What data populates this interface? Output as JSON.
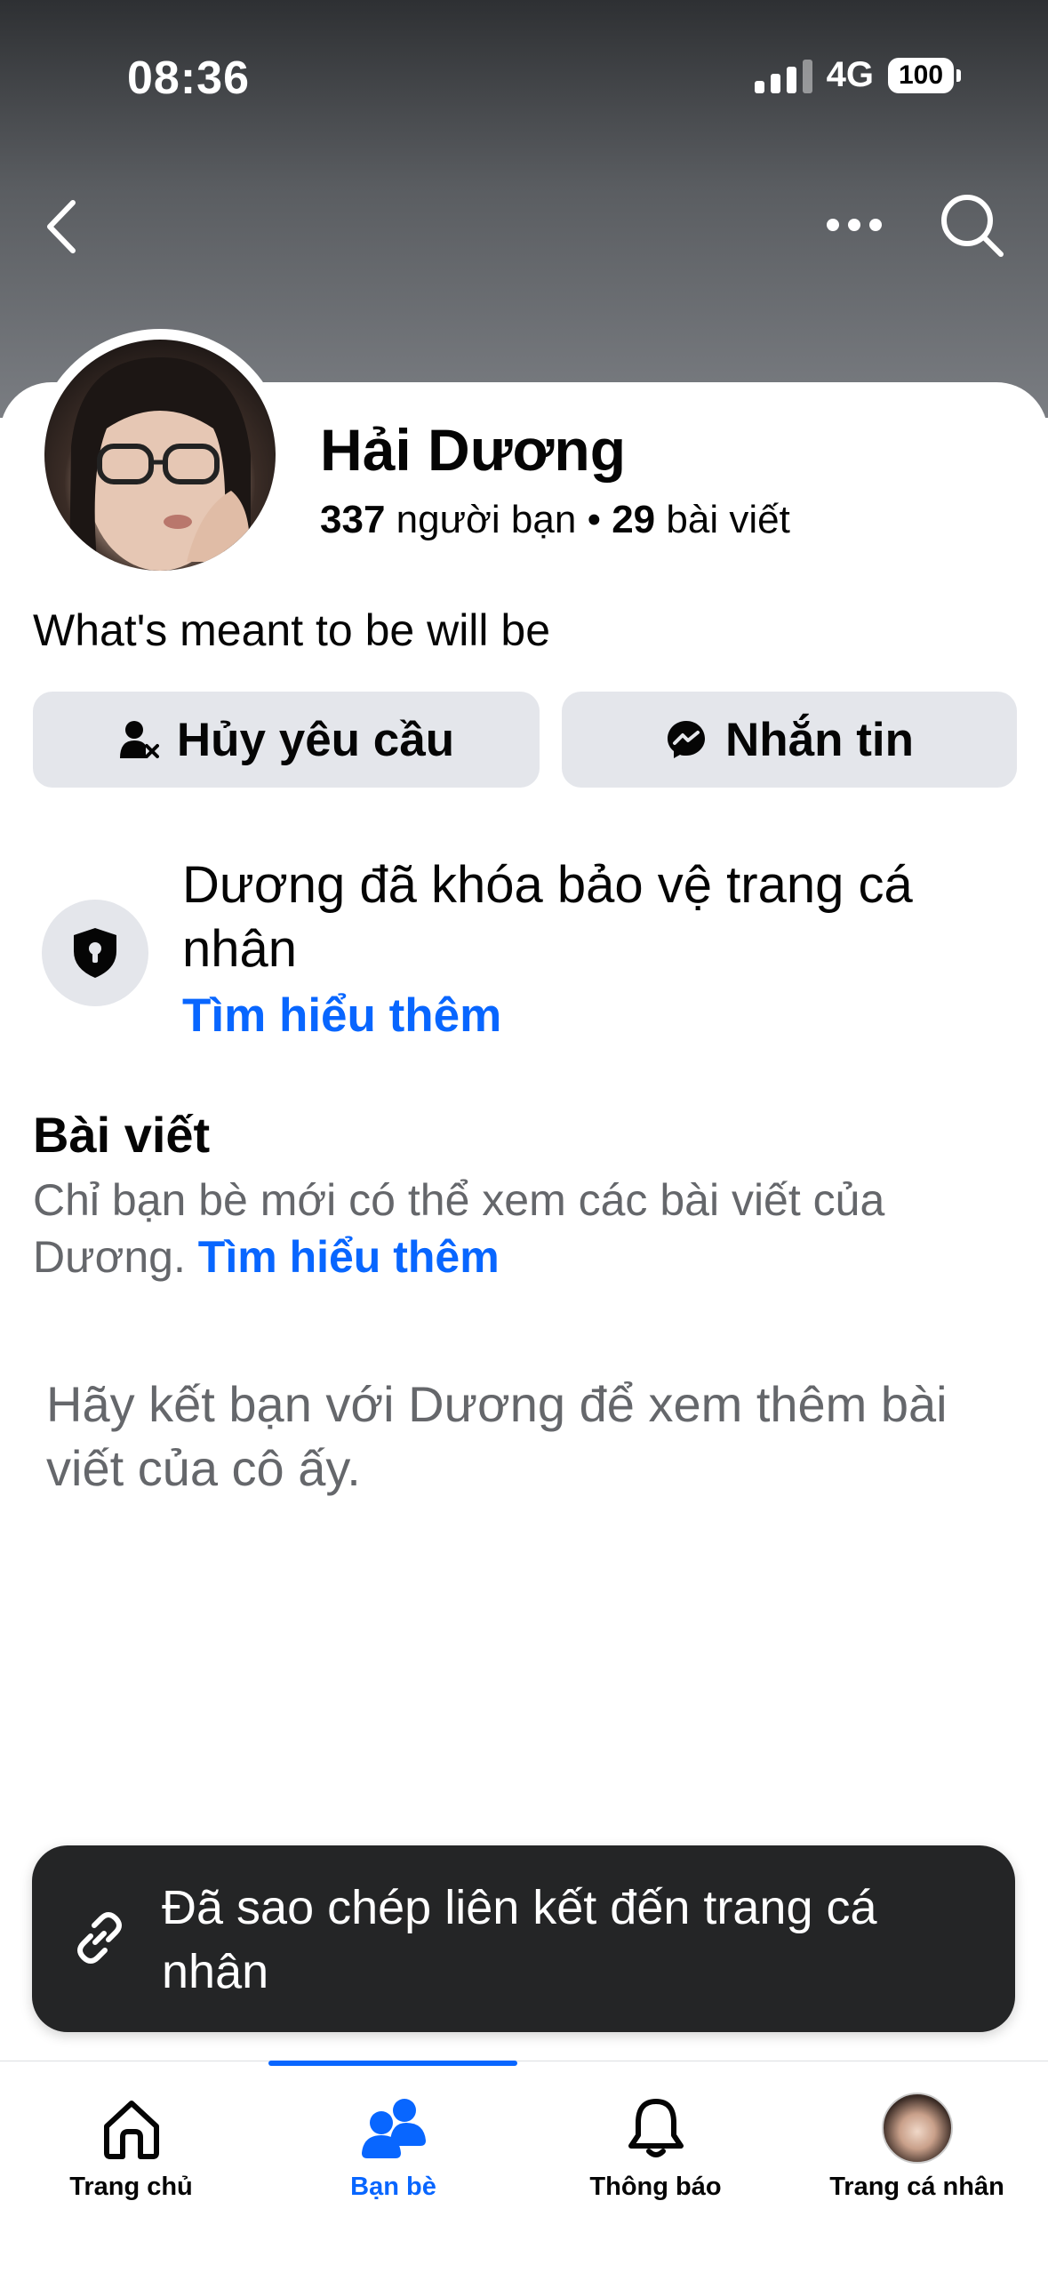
{
  "status_bar": {
    "time": "08:36",
    "network": "4G",
    "battery": "100"
  },
  "nav": {
    "back_icon": "chevron-left-icon",
    "more_icon": "more-horizontal-icon",
    "search_icon": "search-icon"
  },
  "profile": {
    "name": "Hải Dương",
    "friends_count": "337",
    "friends_label": "người bạn",
    "separator": "•",
    "posts_count": "29",
    "posts_label": "bài viết",
    "bio": "What's meant to be will be"
  },
  "actions": {
    "cancel_request": "Hủy yêu cầu",
    "message": "Nhắn tin"
  },
  "locked": {
    "title": "Dương đã khóa bảo vệ trang cá nhân",
    "learn_more": "Tìm hiểu thêm"
  },
  "posts": {
    "title": "Bài viết",
    "description": "Chỉ bạn bè mới có thể xem các bài viết của Dương.",
    "learn_more": "Tìm hiểu thêm",
    "friend_prompt": "Hãy kết bạn với Dương để xem thêm bài viết của cô ấy."
  },
  "toast": {
    "icon": "link-icon",
    "text": "Đã sao chép liên kết đến trang cá nhân"
  },
  "tabs": [
    {
      "label": "Trang chủ",
      "icon": "home-icon",
      "active": false
    },
    {
      "label": "Bạn bè",
      "icon": "friends-icon",
      "active": true
    },
    {
      "label": "Thông báo",
      "icon": "bell-icon",
      "active": false
    },
    {
      "label": "Trang cá nhân",
      "icon": "profile-avatar",
      "active": false
    }
  ],
  "colors": {
    "accent": "#0866ff",
    "button_bg": "#e4e6eb",
    "toast_bg": "#242526",
    "secondary_text": "#65676b"
  }
}
